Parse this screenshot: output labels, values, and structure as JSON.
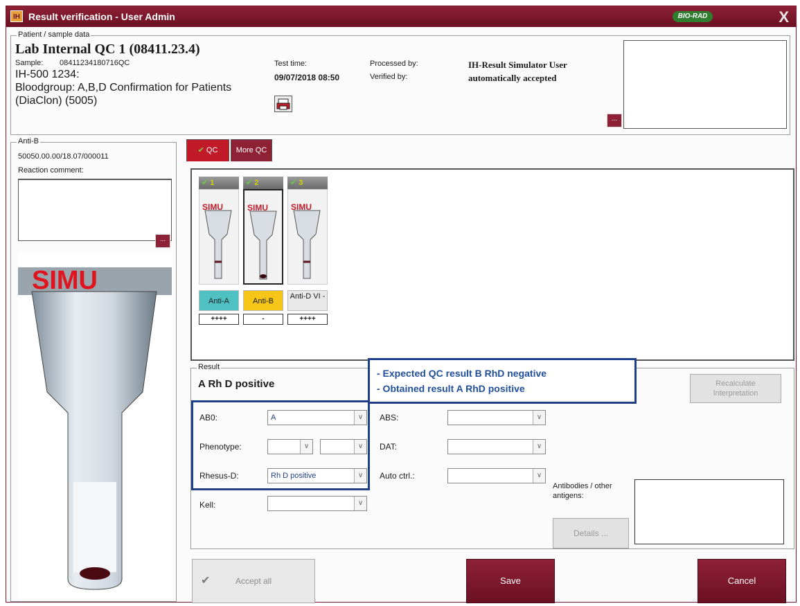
{
  "window": {
    "title": "Result verification - User Admin",
    "app_icon": "IH",
    "brand": "BIO-RAD",
    "close": "X"
  },
  "patient": {
    "legend": "Patient / sample data",
    "name": "Lab Internal QC 1 (08411.23.4)",
    "sample_label": "Sample:",
    "sample_value": "08411234180716QC",
    "device": "IH-500 1234:",
    "test_line1": "Bloodgroup: A,B,D Confirmation for Patients",
    "test_line2": "(DiaClon) (5005)",
    "test_time_label": "Test time:",
    "test_time_value": "09/07/2018 08:50",
    "processed_label": "Processed by:",
    "processed_value": "IH-Result Simulator User",
    "verified_label": "Verified by:",
    "verified_value": "automatically accepted",
    "dots": "..."
  },
  "antib": {
    "legend": "Anti-B",
    "code": "50050.00.00/18.07/000011",
    "reaction_comment_label": "Reaction comment:",
    "dots": "...",
    "image_caption": "SIMU"
  },
  "tabs": [
    {
      "label": "QC"
    },
    {
      "label": "More QC"
    }
  ],
  "wells": [
    {
      "num": "1",
      "agent": "Anti-A",
      "result": "++++",
      "color": "#4fc1c3",
      "caption": "SIMU"
    },
    {
      "num": "2",
      "agent": "Anti-B",
      "result": "-",
      "color": "#f5c518",
      "caption": "SIMU"
    },
    {
      "num": "3",
      "agent": "Anti-D VI -",
      "result": "++++",
      "color": "#e8e8e8",
      "caption": "SIMU"
    }
  ],
  "result": {
    "legend": "Result",
    "main": "A Rh D positive",
    "recalc_line1": "Recalculate",
    "recalc_line2": "Interpretation",
    "abo_label": "AB0:",
    "abo_value": "A",
    "phenotype_label": "Phenotype:",
    "rhesus_label": "Rhesus-D:",
    "rhesus_value": "Rh D positive",
    "kell_label": "Kell:",
    "abs_label": "ABS:",
    "dat_label": "DAT:",
    "auto_label": "Auto ctrl.:",
    "antibodies_line1": "Antibodies / other",
    "antibodies_line2": "antigens:",
    "details": "Details ..."
  },
  "callout": {
    "line1": "- Expected QC result B RhD negative",
    "line2": "- Obtained result A RhD positive"
  },
  "buttons": {
    "accept": "Accept all",
    "save": "Save",
    "cancel": "Cancel"
  },
  "colors": {
    "accent": "#8e2136",
    "callout": "#1f3f8a",
    "qc_tab": "#c11b2a"
  }
}
